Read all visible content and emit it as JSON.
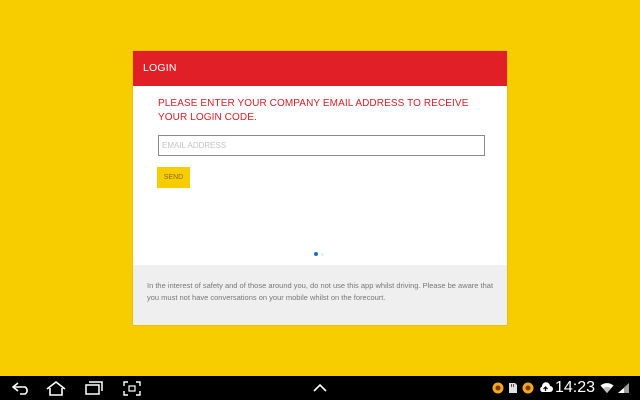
{
  "login": {
    "header_title": "LOGIN",
    "instruction": "PLEASE ENTER YOUR COMPANY EMAIL ADDRESS TO RECEIVE YOUR LOGIN CODE.",
    "email_placeholder": "EMAIL ADDRESS",
    "email_value": "",
    "send_label": "SEND",
    "footer_notice": "In the interest of safety and of those around you, do not use this app whilst driving. Please be aware that you must not have conversations on your mobile whilst on the forecourt."
  },
  "colors": {
    "background": "#f8cd00",
    "header": "#e11f26",
    "instruction_text": "#d82027",
    "button": "#f8cd00",
    "footer_bg": "#efefef"
  },
  "system_bar": {
    "time": "14:23",
    "icons": [
      "back-icon",
      "home-icon",
      "recent-apps-icon",
      "screenshot-icon",
      "up-arrow-icon",
      "notification-app-icon",
      "sd-card-icon",
      "notification-app-icon-2",
      "cloud-upload-icon",
      "wifi-icon",
      "signal-icon"
    ]
  }
}
